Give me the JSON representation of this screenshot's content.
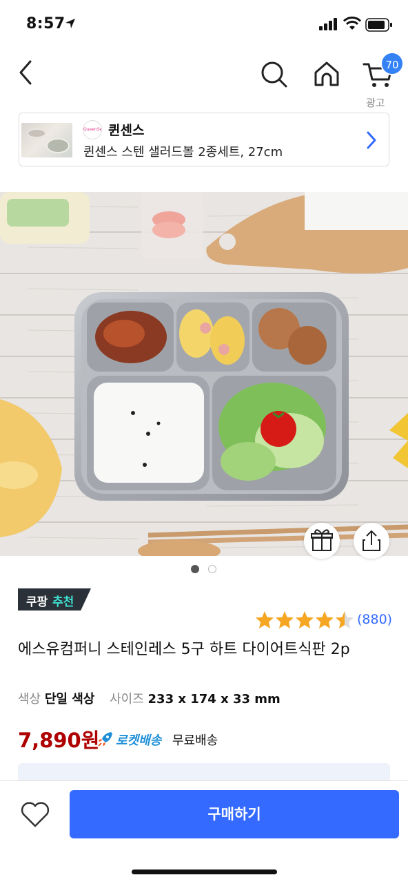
{
  "status_bar": {
    "time": "8:57"
  },
  "nav": {
    "cart_count": "70",
    "ad_label": "광고"
  },
  "ad_card": {
    "logo_text": "QueenSense",
    "brand": "퀸센스",
    "product": "퀸센스 스텐 샐러드볼 2종세트, 27cm"
  },
  "carousel": {
    "total": 2,
    "active": 1
  },
  "badge": {
    "part1": "쿠팡",
    "part2": "추천"
  },
  "rating": {
    "stars": 4.5,
    "count": "(880)"
  },
  "product": {
    "title": "에스유컴퍼니 스테인레스 5구 하트 다이어트식판 2p",
    "options": [
      {
        "key": "색상",
        "value": "단일 색상"
      },
      {
        "key": "사이즈",
        "value": "233 x 174 x 33 mm"
      }
    ],
    "price": "7,890원",
    "delivery": "로켓배송",
    "shipping": "무료배송"
  },
  "bottom": {
    "buy_label": "구매하기"
  },
  "colors": {
    "accent": "#346aff",
    "price": "#ae0000",
    "star": "#f5a623",
    "badge_bg": "#2a3138"
  }
}
